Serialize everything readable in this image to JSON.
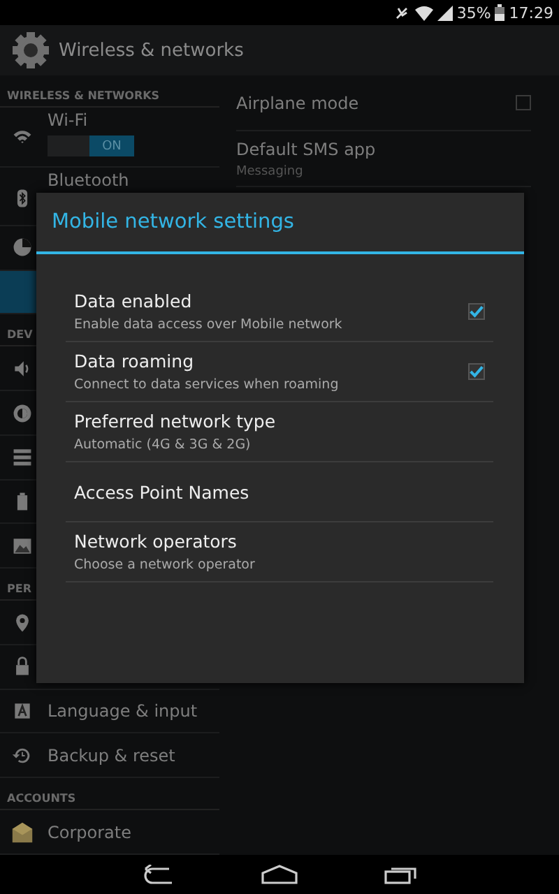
{
  "status_bar": {
    "battery": "35%",
    "time": "17:29"
  },
  "action_bar": {
    "title": "Wireless & networks"
  },
  "sidebar": {
    "items": [
      {
        "kind": "header",
        "label": "WIRELESS & NETWORKS"
      },
      {
        "kind": "toggle",
        "label": "Wi-Fi",
        "selected": false,
        "switch": {
          "label": "ON",
          "on": true
        }
      },
      {
        "kind": "toggle",
        "label": "Bluetooth",
        "selected": false
      },
      {
        "kind": "item",
        "selected": false
      },
      {
        "kind": "item",
        "selected": true
      },
      {
        "kind": "header",
        "label": "DEV"
      },
      {
        "kind": "item",
        "selected": false
      },
      {
        "kind": "item",
        "selected": false
      },
      {
        "kind": "item",
        "selected": false
      },
      {
        "kind": "item",
        "selected": false
      },
      {
        "kind": "item",
        "selected": false
      },
      {
        "kind": "header",
        "label": "PER"
      },
      {
        "kind": "item",
        "selected": false
      },
      {
        "kind": "item",
        "selected": false
      },
      {
        "kind": "item",
        "label": "Language & input",
        "selected": false
      },
      {
        "kind": "item",
        "label": "Backup & reset",
        "selected": false
      },
      {
        "kind": "header",
        "label": "ACCOUNTS"
      },
      {
        "kind": "item",
        "label": "Corporate",
        "selected": false
      }
    ]
  },
  "content": {
    "items": [
      {
        "title": "Airplane mode",
        "checked": false
      },
      {
        "title": "Default SMS app",
        "summary": "Messaging"
      }
    ]
  },
  "dialog": {
    "title": "Mobile network settings",
    "items": [
      {
        "title": "Data enabled",
        "summary": "Enable data access over Mobile network",
        "checked": true
      },
      {
        "title": "Data roaming",
        "summary": "Connect to data services when roaming",
        "checked": true
      },
      {
        "title": "Preferred network type",
        "summary": "Automatic (4G & 3G & 2G)"
      },
      {
        "title": "Access Point Names"
      },
      {
        "title": "Network operators",
        "summary": "Choose a network operator"
      }
    ]
  }
}
